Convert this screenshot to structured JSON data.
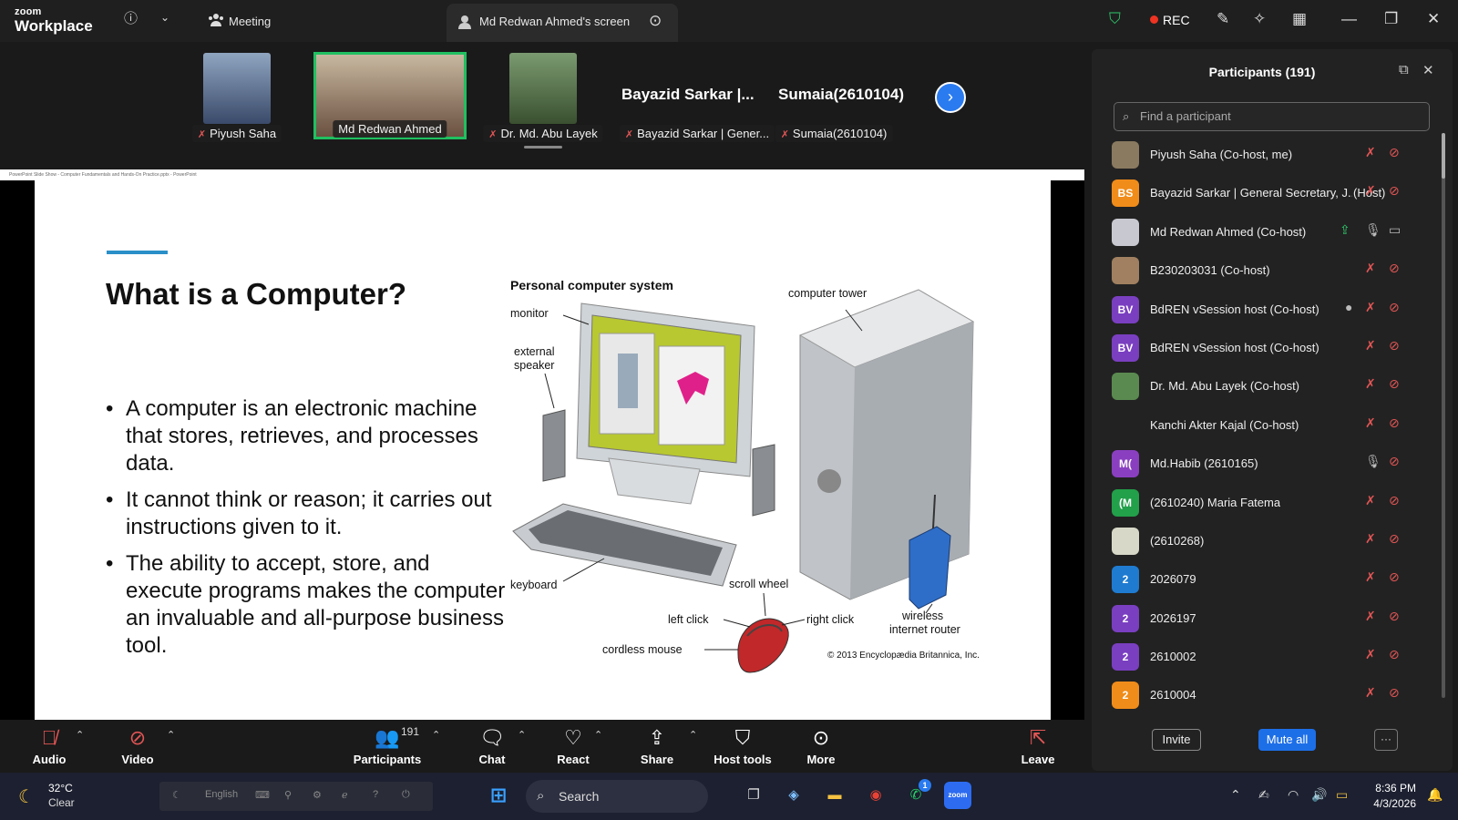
{
  "app": {
    "brand_top": "zoom",
    "brand_bottom": "Workplace",
    "meeting_label": "Meeting",
    "screen_tab_label": "Md Redwan Ahmed's screen",
    "rec_label": "REC"
  },
  "video_strip": {
    "tiles": [
      {
        "name": "Piyush Saha"
      },
      {
        "name": "Md Redwan Ahmed"
      },
      {
        "name": "Dr. Md. Abu Layek"
      },
      {
        "name": "Bayazid Sarkar | Gener..."
      },
      {
        "name": "Sumaia(2610104)"
      }
    ],
    "big_names": [
      "Bayazid Sarkar |...",
      "Sumaia(2610104)"
    ]
  },
  "slide": {
    "window_title": "PowerPoint Slide Show  -  Computer Fundamentals and Hands-On Practice.pptx - PowerPoint",
    "title": "What is a Computer?",
    "bullets": [
      "A computer is an electronic machine that stores, retrieves, and processes data.",
      "It cannot think or reason; it carries out instructions given to it.",
      "The ability to accept, store, and execute programs makes the computer an invaluable and all-purpose business tool."
    ],
    "figure": {
      "heading": "Personal computer system",
      "labels": {
        "monitor": "monitor",
        "speaker_1": "external",
        "speaker_2": "speaker",
        "tower": "computer tower",
        "keyboard": "keyboard",
        "scroll": "scroll wheel",
        "left_click": "left click",
        "right_click": "right click",
        "mouse": "cordless mouse",
        "router_1": "wireless",
        "router_2": "internet router",
        "copyright": "© 2013 Encyclopædia Britannica, Inc."
      }
    }
  },
  "participants_panel": {
    "title": "Participants (191)",
    "search_placeholder": "Find a participant",
    "participants": [
      {
        "name": "Piyush Saha (Co-host, me)",
        "role": "",
        "initials": "",
        "avatar_color": "#8a7a60"
      },
      {
        "name": "Bayazid Sarkar | General Secretary, J...",
        "role": "(Host)",
        "initials": "BS",
        "avatar_color": "#f08c1a"
      },
      {
        "name": "Md Redwan Ahmed (Co-host)",
        "role": "",
        "initials": "",
        "avatar_color": "#c8c8d0"
      },
      {
        "name": "B230203031 (Co-host)",
        "role": "",
        "initials": "",
        "avatar_color": "#a08060"
      },
      {
        "name": "BdREN vSession host (Co-host)",
        "role": "",
        "initials": "BV",
        "avatar_color": "#7a3fc0"
      },
      {
        "name": "BdREN vSession host (Co-host)",
        "role": "",
        "initials": "BV",
        "avatar_color": "#7a3fc0"
      },
      {
        "name": "Dr. Md. Abu Layek (Co-host)",
        "role": "",
        "initials": "",
        "avatar_color": "#5a8a50"
      },
      {
        "name": "Kanchi Akter Kajal (Co-host)",
        "role": "",
        "initials": "",
        "avatar_color": "#222"
      },
      {
        "name": "Md.Habib (2610165)",
        "role": "",
        "initials": "M(",
        "avatar_color": "#8a3fc0"
      },
      {
        "name": "(2610240) Maria Fatema",
        "role": "",
        "initials": "(M",
        "avatar_color": "#22a04a"
      },
      {
        "name": "(2610268)",
        "role": "",
        "initials": "",
        "avatar_color": "#d8d8c8"
      },
      {
        "name": "2026079",
        "role": "",
        "initials": "2",
        "avatar_color": "#1f7bd0"
      },
      {
        "name": "2026197",
        "role": "",
        "initials": "2",
        "avatar_color": "#7a3fc0"
      },
      {
        "name": "2610002",
        "role": "",
        "initials": "2",
        "avatar_color": "#7a3fc0"
      },
      {
        "name": "2610004",
        "role": "",
        "initials": "2",
        "avatar_color": "#f08c1a"
      }
    ],
    "invite_label": "Invite",
    "mute_all_label": "Mute all",
    "more_label": "···"
  },
  "toolbar": {
    "audio": "Audio",
    "video": "Video",
    "participants": "Participants",
    "participants_count": "191",
    "chat": "Chat",
    "react": "React",
    "share": "Share",
    "host_tools": "Host tools",
    "more": "More",
    "leave": "Leave"
  },
  "taskbar": {
    "temperature": "32°C",
    "condition": "Clear",
    "language": "English",
    "search_label": "Search",
    "time": "8:36 PM",
    "date": "4/3/2026",
    "whatsapp_badge": "1"
  }
}
